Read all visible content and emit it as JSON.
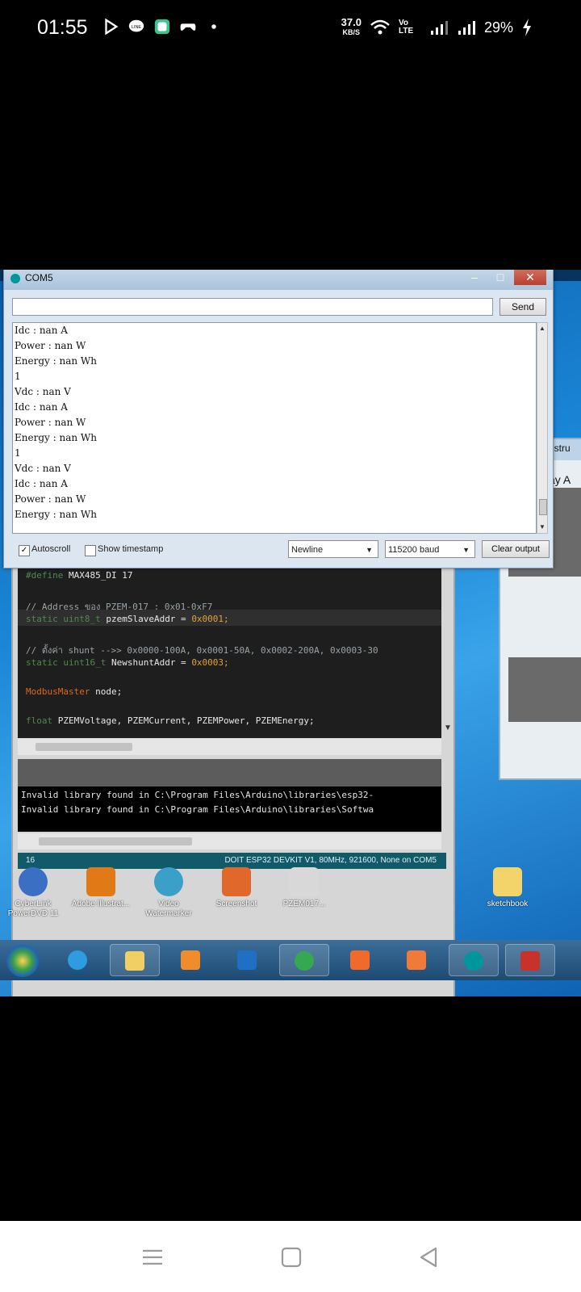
{
  "status_bar": {
    "time": "01:55",
    "net_speed_value": "37.0",
    "net_speed_unit": "KB/S",
    "volte": "Vo LTE",
    "battery": "29%",
    "notif_icons": [
      "play-icon",
      "line-icon",
      "chat-icon",
      "game-controller-icon",
      "dot-icon"
    ],
    "system_icons": [
      "wifi-icon",
      "volte-icon",
      "signal-icon",
      "signal-icon",
      "charging-icon"
    ]
  },
  "serial_monitor": {
    "title": "COM5",
    "send_label": "Send",
    "input_value": "",
    "output_lines": [
      "Idc : nan A",
      "Power : nan W",
      "Energy : nan Wh",
      "1",
      "Vdc : nan V",
      "Idc : nan A",
      "Power : nan W",
      "Energy : nan Wh",
      "1",
      "Vdc : nan V",
      "Idc : nan A",
      "Power : nan W",
      "Energy : nan Wh"
    ],
    "autoscroll_label": "Autoscroll",
    "autoscroll_checked": true,
    "timestamp_label": "Show timestamp",
    "timestamp_checked": false,
    "line_ending": "Newline",
    "baud": "115200 baud",
    "clear_label": "Clear output"
  },
  "ide": {
    "code_lines": [
      {
        "kw": "#define",
        "text": " MAX485_DI  17"
      },
      {
        "comment": "// Address ของ PZEM-017 : 0x01-0xF7"
      },
      {
        "kw": "static uint8_t",
        "text": " pzemSlaveAddr = ",
        "num": "0x0001;"
      },
      {
        "comment": "// ตั้งค่า shunt -->> 0x0000-100A, 0x0001-50A, 0x0002-200A, 0x0003-30"
      },
      {
        "kw": "static uint16_t",
        "text": " NewshuntAddr = ",
        "num": "0x0003;"
      },
      {
        "type": "ModbusMaster",
        "text": " node;"
      },
      {
        "kw": "float",
        "text": " PZEMVoltage, PZEMCurrent, PZEMPower, PZEMEnergy;"
      }
    ],
    "console_lines": [
      "Invalid library found in C:\\Program Files\\Arduino\\libraries\\esp32-",
      "Invalid library found in C:\\Program Files\\Arduino\\libraries\\Softwa"
    ],
    "line_number": "16",
    "board": "DOIT ESP32 DEVKIT V1, 80MHz, 921600, None on COM5"
  },
  "background_window": {
    "title": "nstru",
    "subtitle": "ay A"
  },
  "desktop_icons": [
    {
      "label": "CyberLink PowerDVD 11",
      "color": "#3b6fc4"
    },
    {
      "label": "Adobe Illustrat...",
      "color": "#e07a16"
    },
    {
      "label": "Video Watermarker",
      "color": "#3aa0c8"
    },
    {
      "label": "Screenshot",
      "color": "#e0682a"
    },
    {
      "label": "PZEM017...",
      "color": "#d8d8d8"
    },
    {
      "label": "sketchbook",
      "color": "#f2d46a"
    }
  ],
  "taskbar_apps": [
    {
      "name": "internet-explorer-icon",
      "color": "#2f9be0"
    },
    {
      "name": "file-explorer-icon",
      "color": "#f2cf63"
    },
    {
      "name": "media-player-icon",
      "color": "#f08c2a"
    },
    {
      "name": "outlook-icon",
      "color": "#1f6fc4"
    },
    {
      "name": "chrome-icon",
      "color": "#36a852"
    },
    {
      "name": "screenshot-app-icon",
      "color": "#f06a2a"
    },
    {
      "name": "camera-app-icon",
      "color": "#f07a3a"
    },
    {
      "name": "arduino-icon",
      "color": "#00979c"
    },
    {
      "name": "pzem-app-icon",
      "color": "#c8322a"
    }
  ]
}
